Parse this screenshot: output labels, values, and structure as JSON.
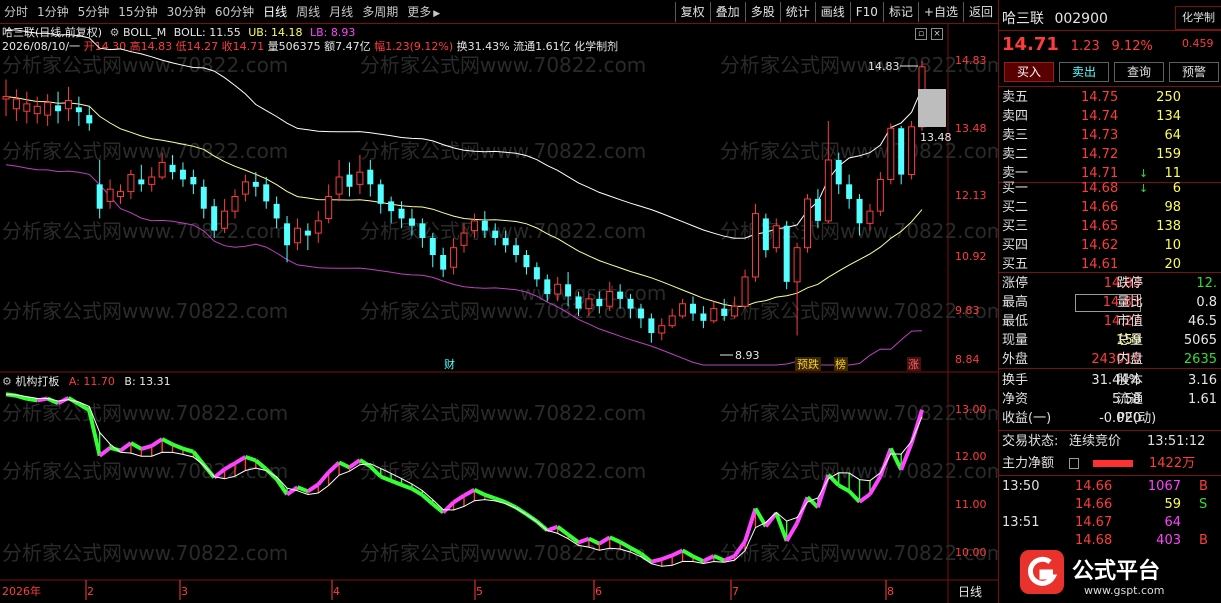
{
  "toolbar": {
    "periods": [
      "分时",
      "1分钟",
      "5分钟",
      "15分钟",
      "30分钟",
      "60分钟",
      "日线",
      "周线",
      "月线",
      "多周期",
      "更多"
    ],
    "tools": [
      "复权",
      "叠加",
      "多股",
      "统计",
      "画线",
      "F10",
      "标记",
      "+自选",
      "返回"
    ]
  },
  "main_chart": {
    "stock_title": "哈三联(日线,前复权)",
    "boll_name": "BOLL_M",
    "boll_label": "BOLL: 11.55",
    "ub_label": "UB: 14.18",
    "lb_label": "LB: 8.93",
    "info_date": "2026/08/10/一",
    "info_open": "开14.30",
    "info_high": "高14.83",
    "info_low": "低14.27",
    "info_close": "收14.71",
    "info_volume": "量506375",
    "info_amount": "额7.47亿",
    "info_change": "幅1.23(9.12%)",
    "info_turnover": "换31.43%",
    "info_float": "流通1.61亿",
    "info_industry": "化学制剂",
    "y_ticks": [
      "14.83",
      "13.48",
      "12.13",
      "10.92",
      "9.83",
      "8.84"
    ],
    "high_marker": "14.83",
    "low_marker": "8.93",
    "cur_price_tag": "13.48",
    "markers": {
      "cai": "财",
      "yudie": "预跌",
      "bang": "榜",
      "zhang": "涨"
    },
    "watermarks": [
      "分析家公式网www.70822.com",
      "www.gspt.com"
    ],
    "candles": [
      [
        14.05,
        14.1,
        13.7,
        14.45
      ],
      [
        13.85,
        14.05,
        13.6,
        14.25
      ],
      [
        13.8,
        13.95,
        13.55,
        14.2
      ],
      [
        13.75,
        13.9,
        13.55,
        14.1
      ],
      [
        13.72,
        13.98,
        13.5,
        14.15
      ],
      [
        13.92,
        13.8,
        13.55,
        14.2
      ],
      [
        13.85,
        14.02,
        13.6,
        14.3
      ],
      [
        13.88,
        13.78,
        13.5,
        14.1
      ],
      [
        13.72,
        13.55,
        13.4,
        13.9
      ],
      [
        12.3,
        11.8,
        11.6,
        12.8
      ],
      [
        11.95,
        12.2,
        11.8,
        12.4
      ],
      [
        12.05,
        12.15,
        11.9,
        12.3
      ],
      [
        12.15,
        12.5,
        12.0,
        12.6
      ],
      [
        12.4,
        12.3,
        12.15,
        12.7
      ],
      [
        12.3,
        12.45,
        12.15,
        12.65
      ],
      [
        12.45,
        12.75,
        12.4,
        12.95
      ],
      [
        12.7,
        12.55,
        12.4,
        12.9
      ],
      [
        12.6,
        12.4,
        12.25,
        12.75
      ],
      [
        12.45,
        12.3,
        12.1,
        12.6
      ],
      [
        12.25,
        11.8,
        11.6,
        12.4
      ],
      [
        11.85,
        11.35,
        11.2,
        12.0
      ],
      [
        11.4,
        11.75,
        11.3,
        12.0
      ],
      [
        11.75,
        12.05,
        11.6,
        12.2
      ],
      [
        12.1,
        12.35,
        11.95,
        12.5
      ],
      [
        12.35,
        12.25,
        12.05,
        12.55
      ],
      [
        12.3,
        11.95,
        11.8,
        12.45
      ],
      [
        11.9,
        11.6,
        11.4,
        12.05
      ],
      [
        11.5,
        11.05,
        10.7,
        11.65
      ],
      [
        11.1,
        11.4,
        10.95,
        11.6
      ],
      [
        11.35,
        11.25,
        10.95,
        11.5
      ],
      [
        11.3,
        11.55,
        11.1,
        11.75
      ],
      [
        11.6,
        12.05,
        11.5,
        12.3
      ],
      [
        12.1,
        12.45,
        11.95,
        12.8
      ],
      [
        12.5,
        12.25,
        12.05,
        12.75
      ],
      [
        12.3,
        12.55,
        12.1,
        12.9
      ],
      [
        12.6,
        12.3,
        12.05,
        12.8
      ],
      [
        12.3,
        11.9,
        11.7,
        12.4
      ],
      [
        11.95,
        11.75,
        11.5,
        12.05
      ],
      [
        11.8,
        11.6,
        11.4,
        11.95
      ],
      [
        11.6,
        11.45,
        11.25,
        11.8
      ],
      [
        11.5,
        11.2,
        11.0,
        11.6
      ],
      [
        11.2,
        10.85,
        10.6,
        11.3
      ],
      [
        10.85,
        10.55,
        10.4,
        11.0
      ],
      [
        10.6,
        11.0,
        10.45,
        11.2
      ],
      [
        11.05,
        11.3,
        10.9,
        11.5
      ],
      [
        11.35,
        11.55,
        11.2,
        11.7
      ],
      [
        11.55,
        11.35,
        11.2,
        11.75
      ],
      [
        11.35,
        11.2,
        11.05,
        11.5
      ],
      [
        11.2,
        11.05,
        10.9,
        11.35
      ],
      [
        11.05,
        10.85,
        10.7,
        11.2
      ],
      [
        10.85,
        10.6,
        10.45,
        10.95
      ],
      [
        10.6,
        10.35,
        10.2,
        10.7
      ],
      [
        10.35,
        10.05,
        9.9,
        10.45
      ],
      [
        10.05,
        10.25,
        9.9,
        10.4
      ],
      [
        10.25,
        10.0,
        9.8,
        10.5
      ],
      [
        10.0,
        9.75,
        9.6,
        10.1
      ],
      [
        9.75,
        9.95,
        9.6,
        10.05
      ],
      [
        9.95,
        9.8,
        9.65,
        10.1
      ],
      [
        9.8,
        10.1,
        9.7,
        10.3
      ],
      [
        10.1,
        9.95,
        9.75,
        10.25
      ],
      [
        9.95,
        9.75,
        9.55,
        10.05
      ],
      [
        9.75,
        9.55,
        9.35,
        9.85
      ],
      [
        9.55,
        9.25,
        9.05,
        9.65
      ],
      [
        9.25,
        9.4,
        9.1,
        9.55
      ],
      [
        9.4,
        9.6,
        9.35,
        9.75
      ],
      [
        9.6,
        9.85,
        9.55,
        9.95
      ],
      [
        9.85,
        9.65,
        9.5,
        10.0
      ],
      [
        9.65,
        9.5,
        9.35,
        9.8
      ],
      [
        9.5,
        9.75,
        9.45,
        9.9
      ],
      [
        9.75,
        9.6,
        9.5,
        9.95
      ],
      [
        9.6,
        9.8,
        9.55,
        10.0
      ],
      [
        9.8,
        10.4,
        9.75,
        10.55
      ],
      [
        10.4,
        11.7,
        10.3,
        11.9
      ],
      [
        11.6,
        10.95,
        10.8,
        11.7
      ],
      [
        11.0,
        11.45,
        10.9,
        11.6
      ],
      [
        11.45,
        10.3,
        10.15,
        11.55
      ],
      [
        10.3,
        11.0,
        9.2,
        11.1
      ],
      [
        11.0,
        12.0,
        10.9,
        12.1
      ],
      [
        12.0,
        11.55,
        11.4,
        12.2
      ],
      [
        11.55,
        12.8,
        11.5,
        13.6
      ],
      [
        12.8,
        12.3,
        12.1,
        12.95
      ],
      [
        12.3,
        12.0,
        11.8,
        12.5
      ],
      [
        12.0,
        11.5,
        11.25,
        12.1
      ],
      [
        11.5,
        11.75,
        11.35,
        11.9
      ],
      [
        11.75,
        12.4,
        11.65,
        12.55
      ],
      [
        12.4,
        13.45,
        12.3,
        13.55
      ],
      [
        13.45,
        12.5,
        12.3,
        13.5
      ],
      [
        12.5,
        13.48,
        12.4,
        13.6
      ],
      [
        13.48,
        14.71,
        13.4,
        14.83
      ]
    ]
  },
  "sub_chart": {
    "title": "机构打板",
    "a_label": "A: 11.70",
    "b_label": "B: 13.31",
    "y_ticks": [
      "13.00",
      "12.00",
      "11.00",
      "10.00"
    ]
  },
  "x_axis": {
    "year_label": "2026年",
    "ticks": [
      "2",
      "3",
      "4",
      "5",
      "6",
      "7",
      "8"
    ],
    "period_label": "日线"
  },
  "panel": {
    "name": "哈三联",
    "code": "002900",
    "tag": "化学制",
    "price": "14.71",
    "change": "1.23",
    "change_pct": "9.12%",
    "side_value": "0.459",
    "buttons": [
      "买入",
      "卖出",
      "查询",
      "预警"
    ],
    "asks": [
      {
        "label": "卖五",
        "price": "14.75",
        "vol": "250",
        "arrow": ""
      },
      {
        "label": "卖四",
        "price": "14.74",
        "vol": "134",
        "arrow": ""
      },
      {
        "label": "卖三",
        "price": "14.73",
        "vol": "64",
        "arrow": ""
      },
      {
        "label": "卖二",
        "price": "14.72",
        "vol": "159",
        "arrow": ""
      },
      {
        "label": "卖一",
        "price": "14.71",
        "vol": "11",
        "arrow": "↓"
      }
    ],
    "bids": [
      {
        "label": "买一",
        "price": "14.68",
        "vol": "6",
        "arrow": "↓"
      },
      {
        "label": "买二",
        "price": "14.66",
        "vol": "98",
        "arrow": ""
      },
      {
        "label": "买三",
        "price": "14.65",
        "vol": "138",
        "arrow": ""
      },
      {
        "label": "买四",
        "price": "14.62",
        "vol": "10",
        "arrow": ""
      },
      {
        "label": "买五",
        "price": "14.61",
        "vol": "20",
        "arrow": ""
      }
    ],
    "stats1": [
      {
        "l1": "涨停",
        "v1": "14.83",
        "l2": "跌停",
        "v2": "12."
      },
      {
        "l1": "最高",
        "v1": "14.83",
        "l2": "量比",
        "v2": "0.8"
      },
      {
        "l1": "最低",
        "v1": "14.27",
        "l2": "市值",
        "v2": "46.5"
      },
      {
        "l1": "现量",
        "v1": "159",
        "l2": "总量",
        "v2": "5065"
      },
      {
        "l1": "外盘",
        "v1": "243010",
        "l2": "内盘",
        "v2": "2635"
      }
    ],
    "stats2": [
      {
        "l1": "换手",
        "v1": "31.44%",
        "l2": "股本",
        "v2": "3.16"
      },
      {
        "l1": "净资",
        "v1": "5.58",
        "l2": "流通",
        "v2": "1.61"
      },
      {
        "l1": "收益(一)",
        "v1": "-0.020",
        "l2": "PE(动)",
        "v2": ""
      }
    ],
    "trade_status_label": "交易状态:",
    "trade_status": "连续竞价",
    "trade_time": "13:51:12",
    "main_flow_label": "主力净额",
    "main_flow_value": "1422万",
    "ticks": [
      {
        "time": "13:50",
        "price": "14.66",
        "vol": "1067",
        "dir": "B"
      },
      {
        "time": "",
        "price": "14.66",
        "vol": "59",
        "dir": "S"
      },
      {
        "time": "13:51",
        "price": "14.67",
        "vol": "64",
        "dir": ""
      },
      {
        "time": "",
        "price": "14.68",
        "vol": "403",
        "dir": "B"
      }
    ],
    "logo_text": "公式平台",
    "logo_url": "www.gspt.com"
  },
  "colors": {
    "up": "#ff3c3c",
    "down": "#54ffff",
    "mid": "#ffff99",
    "upper": "#ffffff",
    "lower": "#c040c0",
    "border": "#7a1010",
    "magenta": "#ff44ff",
    "green": "#33ff33"
  }
}
